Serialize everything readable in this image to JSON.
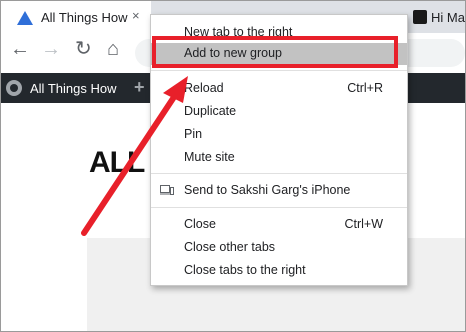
{
  "tabs": {
    "active_title": "All Things How",
    "close_glyph": "×",
    "second_title": "Hi Mar Mor Cr ative Ficti"
  },
  "toolbar": {
    "back_icon": "←",
    "forward_icon": "→",
    "reload_icon": "↻",
    "home_icon": "⌂"
  },
  "wp_bar": {
    "site_name": "All Things How",
    "new_glyph": "+"
  },
  "page": {
    "logo_text": "ALL"
  },
  "context_menu": {
    "items": [
      {
        "label": "New tab to the right",
        "shortcut": ""
      },
      {
        "label": "Add to new group",
        "shortcut": ""
      },
      {
        "label": "Reload",
        "shortcut": "Ctrl+R"
      },
      {
        "label": "Duplicate",
        "shortcut": ""
      },
      {
        "label": "Pin",
        "shortcut": ""
      },
      {
        "label": "Mute site",
        "shortcut": ""
      },
      {
        "label": "Send to Sakshi Garg's iPhone",
        "shortcut": ""
      },
      {
        "label": "Close",
        "shortcut": "Ctrl+W"
      },
      {
        "label": "Close other tabs",
        "shortcut": ""
      },
      {
        "label": "Close tabs to the right",
        "shortcut": ""
      }
    ],
    "highlighted_item": "Add to new group"
  },
  "colors": {
    "annotation_red": "#e8202a",
    "wp_bar": "#23282d",
    "favicon_blue": "#2f6fd8"
  }
}
